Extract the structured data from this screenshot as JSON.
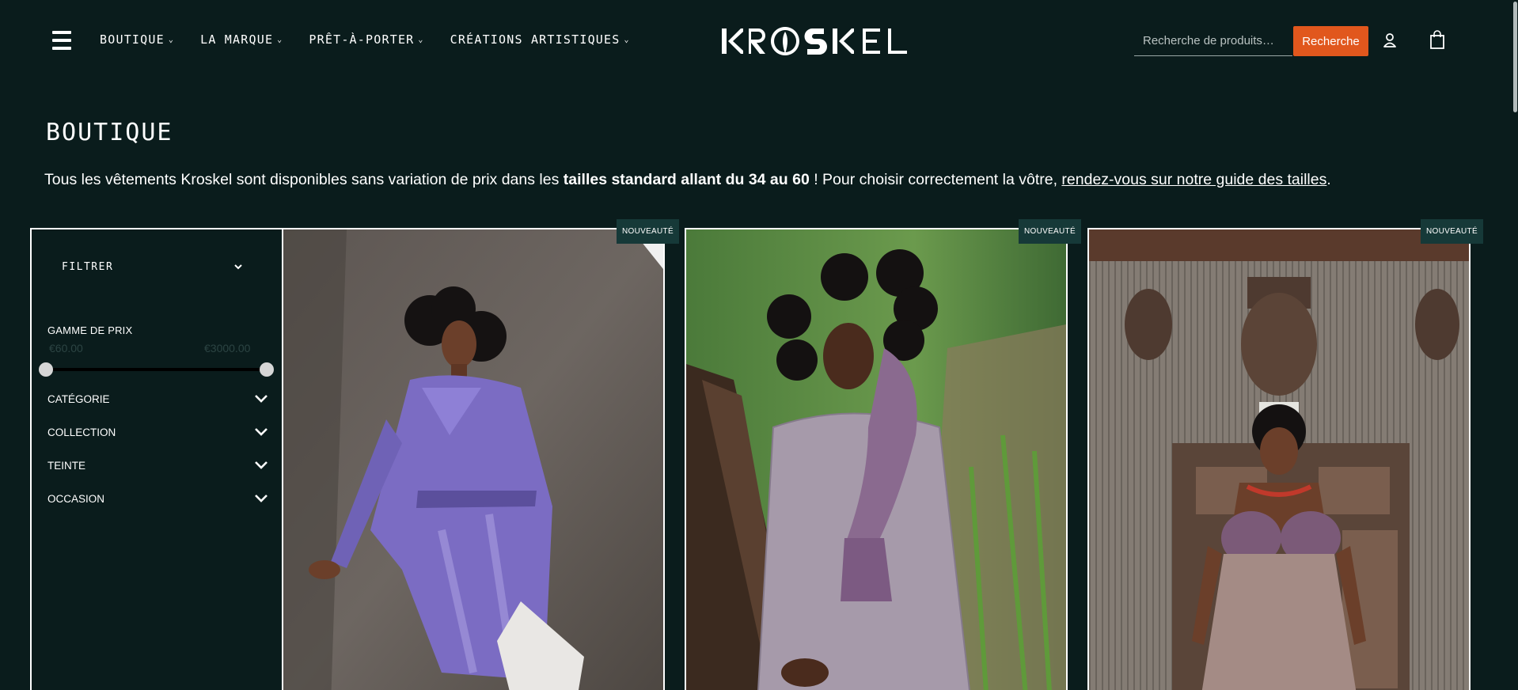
{
  "header": {
    "nav": [
      {
        "label": "BOUTIQUE"
      },
      {
        "label": "LA MARQUE"
      },
      {
        "label": "PRÊT-À-PORTER"
      },
      {
        "label": "CRÉATIONS ARTISTIQUES"
      }
    ],
    "logo_text": "KROSKEL",
    "search": {
      "placeholder": "Recherche de produits…",
      "value": "",
      "button_label": "Recherche"
    },
    "icons": {
      "menu": "hamburger-menu-icon",
      "account": "user-icon",
      "cart": "shopping-bag-icon"
    }
  },
  "page": {
    "title": "BOUTIQUE",
    "intro_part1": "Tous les vêtements Kroskel sont disponibles sans variation de prix dans les ",
    "intro_bold": "tailles standard allant du 34 au 60",
    "intro_part2": " ! Pour choisir correctement la vôtre, ",
    "intro_link": "rendez-vous sur notre guide des tailles",
    "intro_end": "."
  },
  "filters": {
    "toggle_label": "FILTRER",
    "price": {
      "label": "GAMME DE PRIX",
      "min_label": "€60.00",
      "max_label": "€3000.00",
      "min": 60,
      "max": 3000
    },
    "facets": [
      {
        "label": "CATÉGORIE"
      },
      {
        "label": "COLLECTION"
      },
      {
        "label": "TEINTE"
      },
      {
        "label": "OCCASION"
      }
    ]
  },
  "products": [
    {
      "badge": "NOUVEAUTÉ",
      "image": "model-purple-trench-coat-rock"
    },
    {
      "badge": "NOUVEAUTÉ",
      "image": "model-woven-jacket-scarf-forest"
    },
    {
      "badge": "NOUVEAUTÉ",
      "image": "model-draped-dress-carved-masks"
    }
  ],
  "colors": {
    "background": "#0a1c1c",
    "accent": "#e1571d",
    "badge": "#163938"
  }
}
